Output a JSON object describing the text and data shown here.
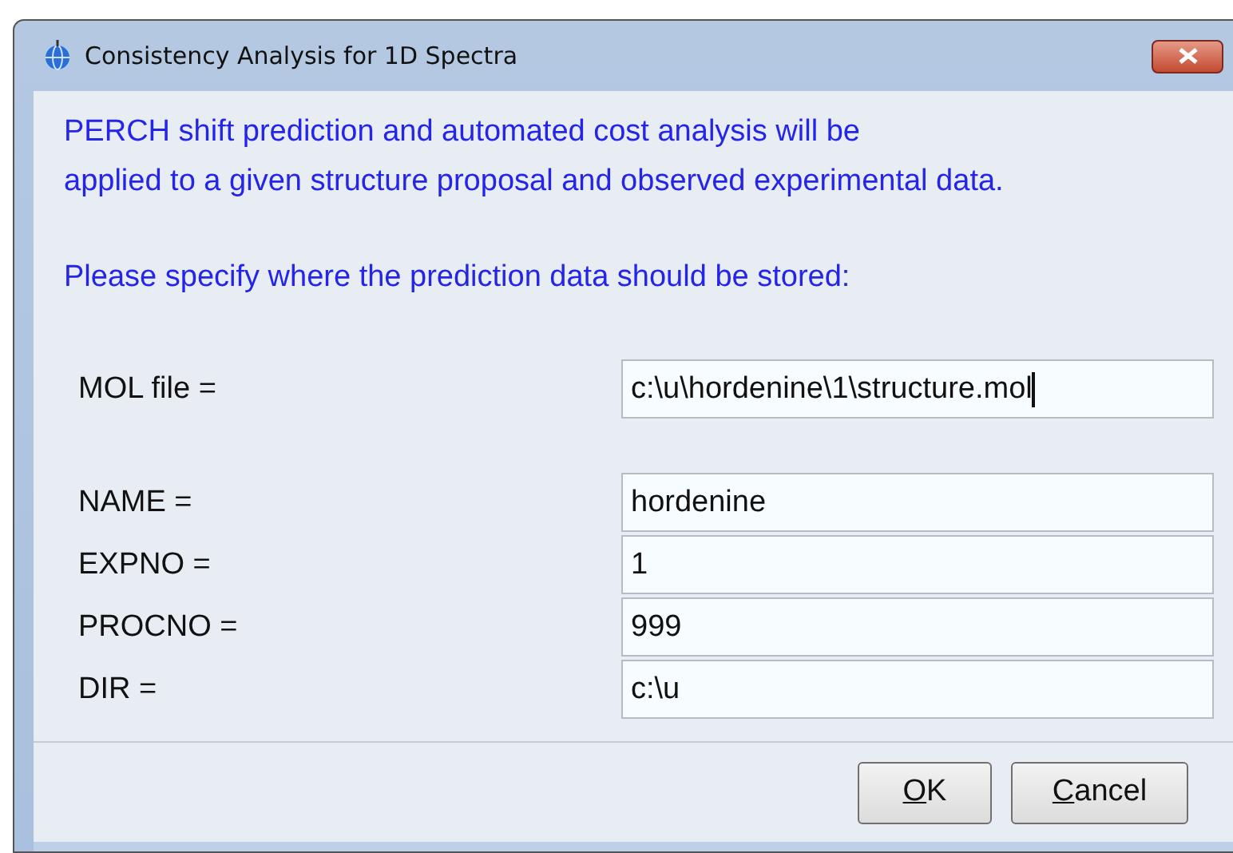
{
  "window": {
    "title": "Consistency Analysis for 1D Spectra"
  },
  "intro": [
    "PERCH shift prediction and automated cost analysis will be",
    "applied to a given structure proposal and observed experimental data."
  ],
  "prompt": "Please specify where the prediction data should be stored:",
  "mol_field": {
    "label": "MOL file =",
    "value": "c:\\u\\hordenine\\1\\structure.mol",
    "focused": true
  },
  "fields": [
    {
      "label": "NAME =",
      "value": "hordenine",
      "focused": false
    },
    {
      "label": "EXPNO =",
      "value": "1",
      "focused": false
    },
    {
      "label": "PROCNO =",
      "value": "999",
      "focused": false
    },
    {
      "label": "DIR =",
      "value": "c:\\u",
      "focused": false
    }
  ],
  "buttons": [
    {
      "label": "OK"
    },
    {
      "label": "Cancel"
    }
  ]
}
